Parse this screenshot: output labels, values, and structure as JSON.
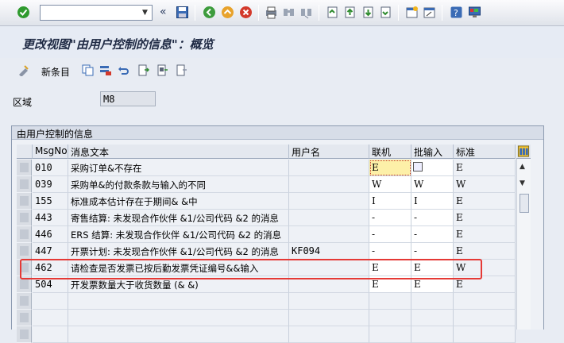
{
  "toolbar": {
    "command_value": "",
    "icons": [
      "check-icon",
      "dropdown-icon",
      "back-arrows-icon",
      "save-icon",
      "back-icon",
      "exit-icon",
      "cancel-icon",
      "print-icon",
      "find-icon",
      "find-next-icon",
      "first-page-icon",
      "prev-page-icon",
      "next-page-icon",
      "last-page-icon",
      "new-session-icon",
      "shortcut-icon",
      "help-icon",
      "layout-icon"
    ]
  },
  "page_title": "更改视图\"由用户控制的信息\"：概览",
  "app_toolbar": {
    "new_entries_label": "新条目"
  },
  "area": {
    "label": "区域",
    "value": "M8"
  },
  "group_title": "由用户控制的信息",
  "table": {
    "headers": {
      "msgno": "MsgNo",
      "text": "消息文本",
      "user": "用户名",
      "online": "联机",
      "batch": "批输入",
      "standard": "标准"
    },
    "rows": [
      {
        "msgno": "010",
        "text": "采购订单&不存在",
        "user": "",
        "online": "E",
        "batch": "",
        "standard": "E"
      },
      {
        "msgno": "039",
        "text": "采购单&的付款条款与输入的不同",
        "user": "",
        "online": "W",
        "batch": "W",
        "standard": "W"
      },
      {
        "msgno": "155",
        "text": "标准成本估计存在于期间& &中",
        "user": "",
        "online": "I",
        "batch": "I",
        "standard": "E"
      },
      {
        "msgno": "443",
        "text": "寄售结算: 未发现合作伙伴 &1/公司代码 &2 的消息",
        "user": "",
        "online": "-",
        "batch": "-",
        "standard": "E"
      },
      {
        "msgno": "446",
        "text": "ERS 结算: 未发现合作伙伴 &1/公司代码 &2 的消息",
        "user": "",
        "online": "-",
        "batch": "-",
        "standard": "E"
      },
      {
        "msgno": "447",
        "text": "开票计划: 未发现合作伙伴 &1/公司代码 &2 的消息",
        "user": "KF094",
        "online": "-",
        "batch": "-",
        "standard": "E"
      },
      {
        "msgno": "462",
        "text": "请检查是否发票已按后勤发票凭证编号&&输入",
        "user": "",
        "online": "E",
        "batch": "E",
        "standard": "W"
      },
      {
        "msgno": "504",
        "text": "开发票数量大于收货数量 (& &)",
        "user": "",
        "online": "E",
        "batch": "E",
        "standard": "E"
      }
    ]
  },
  "colors": {
    "highlight": "#e53935",
    "selected_cell": "#fdf0a8"
  }
}
